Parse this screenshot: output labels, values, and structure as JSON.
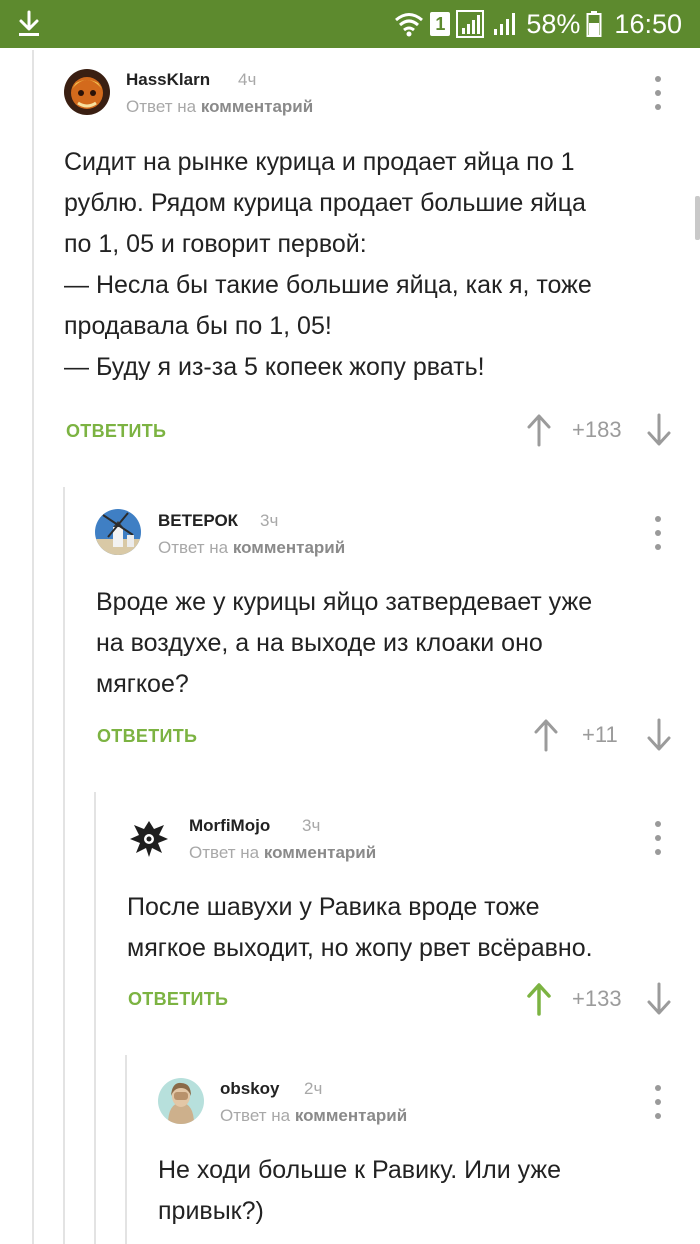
{
  "status_bar": {
    "sim_number": "1",
    "battery": "58%",
    "time": "16:50",
    "background": "#5d8a2e"
  },
  "reply_prefix": "Ответ на",
  "reply_target": "комментарий",
  "reply_button": "ОТВЕТИТЬ",
  "accent_green": "#7cb342",
  "comments": [
    {
      "author": "HassKlarn",
      "age": "4ч",
      "lines": [
        "Сидит на рынке курица и продает яйца по 1",
        "рублю. Рядом курица продает большие яйца",
        "по 1, 05 и говорит первой:",
        "— Несла бы такие большие яйца, как я, тоже",
        "продавала бы по 1, 05!",
        "— Буду я из-за 5 копеек жопу рвать!"
      ],
      "score": "+183",
      "upvoted": false
    },
    {
      "author": "ВЕТЕРОК",
      "age": "3ч",
      "lines": [
        "Вроде же у курицы яйцо затвердевает уже",
        "на воздухе, а на выходе из клоаки оно",
        "мягкое?"
      ],
      "score": "+11",
      "upvoted": false
    },
    {
      "author": "MorfiMojo",
      "age": "3ч",
      "lines": [
        "После шавухи у Равика вроде тоже",
        "мягкое выходит, но жопу рвет всёравно."
      ],
      "score": "+133",
      "upvoted": true
    },
    {
      "author": "obskoy",
      "age": "2ч",
      "lines": [
        "Не ходи больше к Равику. Или уже",
        "привык?)"
      ]
    }
  ]
}
